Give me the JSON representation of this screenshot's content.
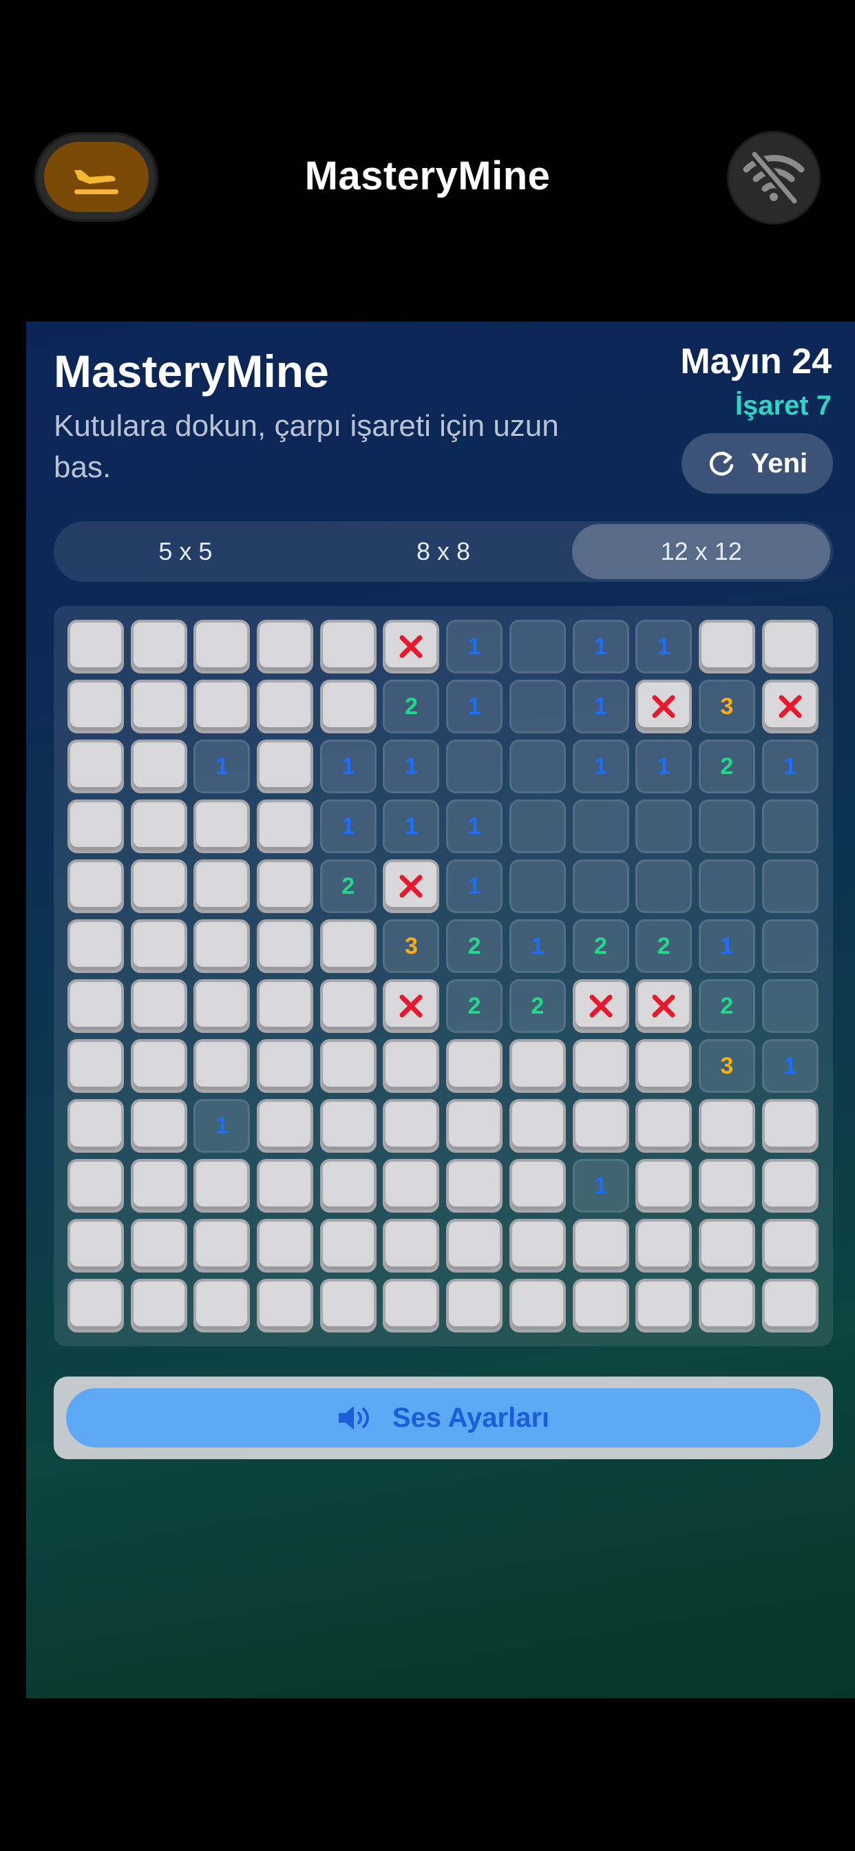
{
  "nav": {
    "title": "MasteryMine"
  },
  "game": {
    "title": "MasteryMine",
    "subtitle": "Kutulara dokun, çarpı işareti için uzun bas.",
    "mines_label": "Mayın 24",
    "flags_label": "İşaret 7",
    "new_label": "Yeni"
  },
  "sizes": [
    {
      "label": "5 x 5",
      "active": false
    },
    {
      "label": "8 x 8",
      "active": false
    },
    {
      "label": "12 x 12",
      "active": true
    }
  ],
  "board": {
    "rows": [
      [
        "H",
        "H",
        "H",
        "H",
        "H",
        "X",
        "1",
        "O",
        "1",
        "1",
        "H",
        "H"
      ],
      [
        "H",
        "H",
        "H",
        "H",
        "H",
        "2",
        "1",
        "O",
        "1",
        "X",
        "3",
        "X"
      ],
      [
        "H",
        "H",
        "1",
        "H",
        "1",
        "1",
        "O",
        "O",
        "1",
        "1",
        "2",
        "1"
      ],
      [
        "H",
        "H",
        "H",
        "H",
        "1",
        "1",
        "1",
        "O",
        "O",
        "O",
        "O",
        "O"
      ],
      [
        "H",
        "H",
        "H",
        "H",
        "2",
        "X",
        "1",
        "O",
        "O",
        "O",
        "O",
        "O"
      ],
      [
        "H",
        "H",
        "H",
        "H",
        "H",
        "3",
        "2",
        "1",
        "2",
        "2",
        "1",
        "O"
      ],
      [
        "H",
        "H",
        "H",
        "H",
        "H",
        "X",
        "2",
        "2",
        "X",
        "X",
        "2",
        "O"
      ],
      [
        "H",
        "H",
        "H",
        "H",
        "H",
        "H",
        "H",
        "H",
        "H",
        "H",
        "3",
        "1"
      ],
      [
        "H",
        "H",
        "1",
        "H",
        "H",
        "H",
        "H",
        "H",
        "H",
        "H",
        "H",
        "H"
      ],
      [
        "H",
        "H",
        "H",
        "H",
        "H",
        "H",
        "H",
        "H",
        "1",
        "H",
        "H",
        "H"
      ],
      [
        "H",
        "H",
        "H",
        "H",
        "H",
        "H",
        "H",
        "H",
        "H",
        "H",
        "H",
        "H"
      ],
      [
        "H",
        "H",
        "H",
        "H",
        "H",
        "H",
        "H",
        "H",
        "H",
        "H",
        "H",
        "H"
      ]
    ],
    "number_colors": {
      "1": "#1e6fff",
      "2": "#22d889",
      "3": "#ffad14"
    },
    "mark_color": "#e8192c"
  },
  "sound": {
    "label": "Ses Ayarları"
  },
  "icons": {
    "left_nav": "airplane-landing-icon",
    "right_nav": "wifi-off-icon",
    "new": "refresh-icon",
    "sound": "speaker-icon",
    "mark": "cross-mark-icon"
  }
}
